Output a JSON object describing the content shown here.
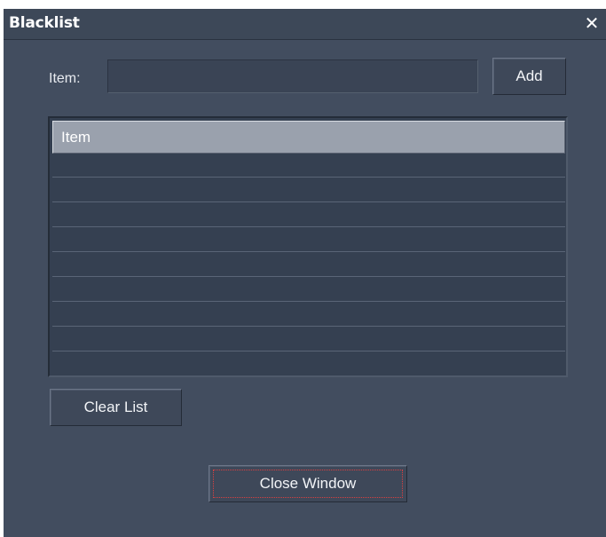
{
  "window": {
    "title": "Blacklist",
    "close_glyph": "✕"
  },
  "form": {
    "item_label": "Item:",
    "item_value": "",
    "item_placeholder": "",
    "add_label": "Add"
  },
  "list": {
    "header": "Item",
    "rows": [
      "",
      "",
      "",
      "",
      "",
      "",
      "",
      "",
      ""
    ]
  },
  "buttons": {
    "clear_label": "Clear List",
    "close_label": "Close Window"
  },
  "colors": {
    "titlebar": "#3d4858",
    "body": "#424d5f",
    "list_bg": "#354051",
    "header_bg": "#9aa1ad",
    "focus": "#d94040"
  }
}
